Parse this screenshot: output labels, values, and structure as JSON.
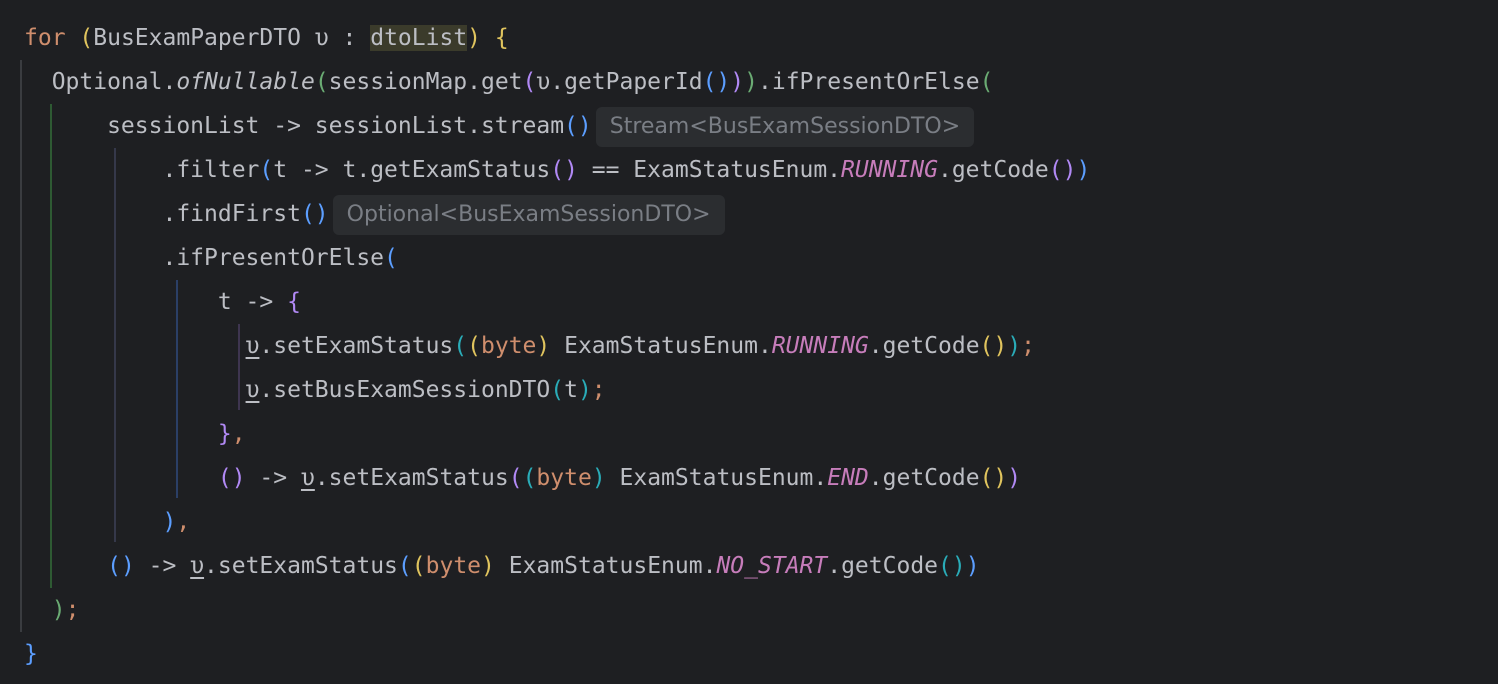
{
  "code_lines": [
    [
      {
        "t": "for",
        "c": "kw"
      },
      {
        "t": " ",
        "c": "plain"
      },
      {
        "t": "(",
        "c": "p-yellow"
      },
      {
        "t": "BusExamPaperDTO",
        "c": "type"
      },
      {
        "t": " υ : ",
        "c": "plain"
      },
      {
        "t": "dtoList",
        "c": "plain highlight"
      },
      {
        "t": ")",
        "c": "p-yellow"
      },
      {
        "t": " ",
        "c": "plain"
      },
      {
        "t": "{",
        "c": "p-yellow"
      }
    ],
    [
      {
        "t": "  Optional.",
        "c": "plain"
      },
      {
        "t": "ofNullable",
        "c": "italic"
      },
      {
        "t": "(",
        "c": "p-green"
      },
      {
        "t": "sessionMap.get",
        "c": "plain"
      },
      {
        "t": "(",
        "c": "p-purple"
      },
      {
        "t": "υ.getPaperId",
        "c": "plain"
      },
      {
        "t": "()",
        "c": "p-blue"
      },
      {
        "t": ")",
        "c": "p-purple"
      },
      {
        "t": ")",
        "c": "p-green"
      },
      {
        "t": ".ifPresentOrElse",
        "c": "plain"
      },
      {
        "t": "(",
        "c": "p-green"
      }
    ],
    [
      {
        "t": "      sessionList -> sessionList.stream",
        "c": "plain"
      },
      {
        "t": "()",
        "c": "p-blue"
      },
      {
        "hint": "Stream<BusExamSessionDTO>"
      }
    ],
    [
      {
        "t": "          .filter",
        "c": "plain"
      },
      {
        "t": "(",
        "c": "p-blue"
      },
      {
        "t": "t -> t.getExamStatus",
        "c": "plain"
      },
      {
        "t": "()",
        "c": "p-purple"
      },
      {
        "t": " == ExamStatusEnum.",
        "c": "plain"
      },
      {
        "t": "RUNNING",
        "c": "constant"
      },
      {
        "t": ".getCode",
        "c": "plain"
      },
      {
        "t": "()",
        "c": "p-purple"
      },
      {
        "t": ")",
        "c": "p-blue"
      }
    ],
    [
      {
        "t": "          .findFirst",
        "c": "plain"
      },
      {
        "t": "()",
        "c": "p-blue"
      },
      {
        "hint": "Optional<BusExamSessionDTO>"
      }
    ],
    [
      {
        "t": "          .ifPresentOrElse",
        "c": "plain"
      },
      {
        "t": "(",
        "c": "p-blue"
      }
    ],
    [
      {
        "t": "              t -> ",
        "c": "plain"
      },
      {
        "t": "{",
        "c": "p-purple"
      }
    ],
    [
      {
        "t": "                ",
        "c": "plain"
      },
      {
        "t": "υ",
        "c": "var-u ul"
      },
      {
        "t": ".setExamStatus",
        "c": "plain"
      },
      {
        "t": "(",
        "c": "p-cyan"
      },
      {
        "t": "(",
        "c": "p-yellow"
      },
      {
        "t": "byte",
        "c": "kw"
      },
      {
        "t": ")",
        "c": "p-yellow"
      },
      {
        "t": " ExamStatusEnum.",
        "c": "plain"
      },
      {
        "t": "RUNNING",
        "c": "constant"
      },
      {
        "t": ".getCode",
        "c": "plain"
      },
      {
        "t": "()",
        "c": "p-yellow"
      },
      {
        "t": ")",
        "c": "p-cyan"
      },
      {
        "t": ";",
        "c": "semi"
      }
    ],
    [
      {
        "t": "                ",
        "c": "plain"
      },
      {
        "t": "υ",
        "c": "var-u ul"
      },
      {
        "t": ".setBusExamSessionDTO",
        "c": "plain"
      },
      {
        "t": "(",
        "c": "p-cyan"
      },
      {
        "t": "t",
        "c": "plain"
      },
      {
        "t": ")",
        "c": "p-cyan"
      },
      {
        "t": ";",
        "c": "semi"
      }
    ],
    [
      {
        "t": "              ",
        "c": "plain"
      },
      {
        "t": "}",
        "c": "p-purple"
      },
      {
        "t": ",",
        "c": "semi"
      }
    ],
    [
      {
        "t": "              ",
        "c": "plain"
      },
      {
        "t": "()",
        "c": "p-purple"
      },
      {
        "t": " -> ",
        "c": "plain"
      },
      {
        "t": "υ",
        "c": "var-u ul"
      },
      {
        "t": ".setExamStatus",
        "c": "plain"
      },
      {
        "t": "(",
        "c": "p-purple"
      },
      {
        "t": "(",
        "c": "p-cyan"
      },
      {
        "t": "byte",
        "c": "kw"
      },
      {
        "t": ")",
        "c": "p-cyan"
      },
      {
        "t": " ExamStatusEnum.",
        "c": "plain"
      },
      {
        "t": "END",
        "c": "constant"
      },
      {
        "t": ".getCode",
        "c": "plain"
      },
      {
        "t": "()",
        "c": "p-yellow"
      },
      {
        "t": ")",
        "c": "p-purple"
      }
    ],
    [
      {
        "t": "          ",
        "c": "plain"
      },
      {
        "t": ")",
        "c": "p-blue"
      },
      {
        "t": ",",
        "c": "semi"
      }
    ],
    [
      {
        "t": "      ",
        "c": "plain"
      },
      {
        "t": "()",
        "c": "p-blue"
      },
      {
        "t": " -> ",
        "c": "plain"
      },
      {
        "t": "υ",
        "c": "var-u ul"
      },
      {
        "t": ".setExamStatus",
        "c": "plain"
      },
      {
        "t": "(",
        "c": "p-blue"
      },
      {
        "t": "(",
        "c": "p-yellow"
      },
      {
        "t": "byte",
        "c": "kw"
      },
      {
        "t": ")",
        "c": "p-yellow"
      },
      {
        "t": " ExamStatusEnum.",
        "c": "plain"
      },
      {
        "t": "NO_START",
        "c": "constant"
      },
      {
        "t": ".getCode",
        "c": "plain"
      },
      {
        "t": "()",
        "c": "p-cyan"
      },
      {
        "t": ")",
        "c": "p-blue"
      }
    ],
    [
      {
        "t": "  ",
        "c": "plain"
      },
      {
        "t": ")",
        "c": "p-green"
      },
      {
        "t": ";",
        "c": "semi"
      }
    ],
    [
      {
        "t": "}",
        "c": "p-blue"
      }
    ]
  ]
}
